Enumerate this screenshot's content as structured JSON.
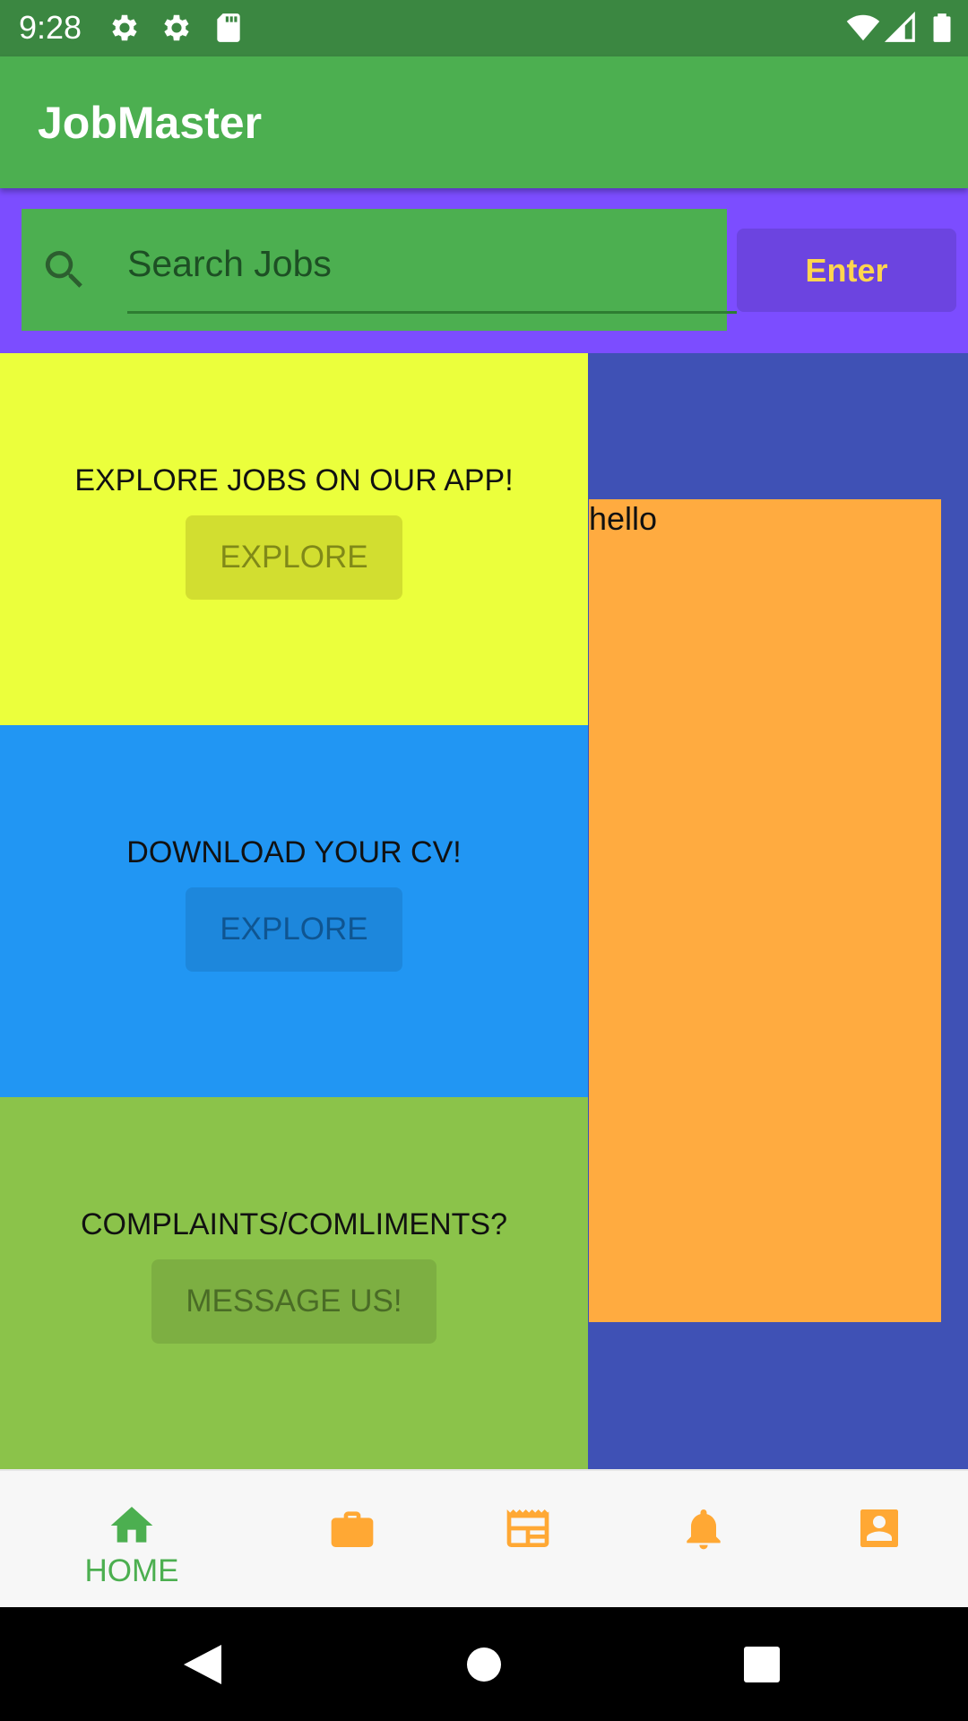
{
  "status_bar": {
    "time": "9:28",
    "icons": [
      "settings-icon",
      "settings-icon",
      "sd-card-icon",
      "wifi-icon",
      "signal-icon",
      "battery-icon"
    ]
  },
  "app_bar": {
    "title": "JobMaster"
  },
  "search": {
    "placeholder": "Search Jobs",
    "value": "",
    "enter_label": "Enter"
  },
  "panels": [
    {
      "title": "EXPLORE JOBS ON OUR APP!",
      "button": "EXPLORE",
      "color": "#ebff3c"
    },
    {
      "title": "DOWNLOAD YOUR CV!",
      "button": "EXPLORE",
      "color": "#2196f3"
    },
    {
      "title": "COMPLAINTS/COMLIMENTS?",
      "button": "MESSAGE US!",
      "color": "#8bc34a"
    }
  ],
  "side_panel": {
    "text": "hello"
  },
  "bottom_nav": {
    "items": [
      {
        "icon": "home-icon",
        "label": "HOME",
        "active": true
      },
      {
        "icon": "briefcase-icon"
      },
      {
        "icon": "newspaper-icon"
      },
      {
        "icon": "bell-icon"
      },
      {
        "icon": "contact-card-icon"
      }
    ]
  },
  "colors": {
    "status_bar": "#3b8741",
    "app_bar": "#4caf50",
    "search_row": "#7c4dff",
    "enter_button": "#6c44e0",
    "enter_text": "#ffd54f",
    "right_column": "#3f51b5",
    "hello_box": "#ffab40",
    "nav_active": "#4caf50",
    "nav_inactive": "#ffa834"
  }
}
